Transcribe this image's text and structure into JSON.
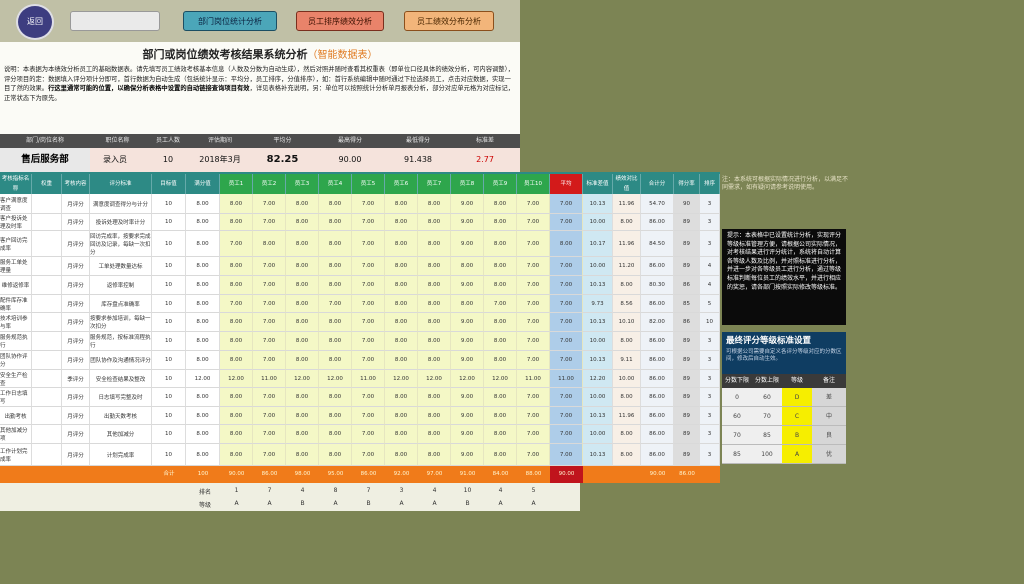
{
  "toolbar": {
    "logo_text": "返回",
    "btn_input": "",
    "btn_dept": "部门岗位统计分析",
    "btn_staff": "员工排序绩效分析",
    "btn_dist": "员工绩效分布分析"
  },
  "header": {
    "title": "部门或岗位绩效考核结果系统分析",
    "subtitle": "（智能数据表）",
    "desc_1": "说明：本表据为本绩效分析员工的基础数据表。请先填写员工绩效考核基本信息（人数及分数为自动生成），然后对照并随时查看其权重表（即单位口径具体的绩效分析，可内容调整），评分项目的定：数据填入评分项计分即可，首行数据为自动生成（包括统计显示：平均分，员工排序，分值排序），如：首行系统编辑中随时通过下拉选择员工，点击对应数据，实现一目了然的效果。",
    "desc_bold": "行这里通常可能的位置，以确保分析表格中设置的自动链接查询项目有效",
    "desc_2": "，详见表格补充说明，另：单位可以按照统计分析单月报表分析，部分对应单元格为对应标记，正常状态下为原先。"
  },
  "info": {
    "headers": [
      "部门/岗位名称",
      "职位名称",
      "员工人数",
      "评估期间",
      "平均分",
      "最高得分",
      "最低得分",
      "标准差"
    ],
    "dept": "售后服务部",
    "position": "录入员",
    "count": "10",
    "period": "2018年3月",
    "avg": "82.25",
    "max": "90.00",
    "min": "91.438",
    "std": "2.77"
  },
  "table": {
    "headers": [
      "考核指标名称",
      "权重",
      "考核内容",
      "评分标准",
      "目标值",
      "满分值",
      "员工1",
      "员工2",
      "员工3",
      "员工4",
      "员工5",
      "员工6",
      "员工7",
      "员工8",
      "员工9",
      "员工10",
      "员工11",
      "平均",
      "标准差值",
      "绩效对比值",
      "合计分",
      "得分率",
      "排序"
    ],
    "rows": [
      {
        "name": "客户满意度调查",
        "weight": "",
        "cat": "月评分",
        "content": "满意度调查得分与计分",
        "target": "10",
        "full": "8.00",
        "s": [
          "8.00",
          "7.00",
          "8.00",
          "8.00",
          "7.00",
          "8.00",
          "8.00",
          "9.00",
          "8.00",
          "7.00",
          "7.00"
        ],
        "avg": "7.73",
        "std": "10.13",
        "cmp": "11.96",
        "sum": "54.70",
        "rate": "90",
        "rank": "3"
      },
      {
        "name": "客户投诉处理及时率",
        "weight": "",
        "cat": "月评分",
        "content": "投诉处理及时率计分",
        "target": "10",
        "full": "8.00",
        "s": [
          "8.00",
          "7.00",
          "8.00",
          "8.00",
          "7.00",
          "8.00",
          "8.00",
          "9.00",
          "8.00",
          "7.00",
          "7.00"
        ],
        "avg": "7.64",
        "std": "10.00",
        "cmp": "8.00",
        "sum": "86.00",
        "rate": "89",
        "rank": "3"
      },
      {
        "name": "客户回访完成率",
        "weight": "",
        "cat": "月评分",
        "content": "回访完成率，按要求完成回访及记录，每缺一次扣分",
        "target": "10",
        "full": "8.00",
        "s": [
          "7.00",
          "8.00",
          "8.00",
          "8.00",
          "7.00",
          "8.00",
          "8.00",
          "9.00",
          "8.00",
          "7.00",
          "8.00"
        ],
        "avg": "7.82",
        "std": "10.17",
        "cmp": "11.96",
        "sum": "84.50",
        "rate": "89",
        "rank": "3"
      },
      {
        "name": "服务工单处理量",
        "weight": "",
        "cat": "月评分",
        "content": "工单处理数量达标",
        "target": "10",
        "full": "8.00",
        "s": [
          "8.00",
          "7.00",
          "8.00",
          "8.00",
          "7.00",
          "8.00",
          "8.00",
          "8.00",
          "8.00",
          "7.00",
          "7.00"
        ],
        "avg": "7.64",
        "std": "10.00",
        "cmp": "11.20",
        "sum": "86.00",
        "rate": "89",
        "rank": "4"
      },
      {
        "name": "维修返修率",
        "weight": "",
        "cat": "月评分",
        "content": "返修率控制",
        "target": "10",
        "full": "8.00",
        "s": [
          "8.00",
          "7.00",
          "8.00",
          "8.00",
          "7.00",
          "8.00",
          "8.00",
          "9.00",
          "8.00",
          "7.00",
          "7.00"
        ],
        "avg": "7.73",
        "std": "10.13",
        "cmp": "8.00",
        "sum": "80.30",
        "rate": "86",
        "rank": "4"
      },
      {
        "name": "配件库存准确率",
        "weight": "",
        "cat": "月评分",
        "content": "库存盘点准确率",
        "target": "10",
        "full": "8.00",
        "s": [
          "7.00",
          "7.00",
          "8.00",
          "7.00",
          "7.00",
          "8.00",
          "8.00",
          "8.00",
          "7.00",
          "7.00",
          "7.00"
        ],
        "avg": "7.36",
        "std": "9.73",
        "cmp": "8.56",
        "sum": "86.00",
        "rate": "85",
        "rank": "5"
      },
      {
        "name": "技术培训参与率",
        "weight": "",
        "cat": "月评分",
        "content": "按要求参加培训，每缺一次扣分",
        "target": "10",
        "full": "8.00",
        "s": [
          "8.00",
          "7.00",
          "8.00",
          "8.00",
          "7.00",
          "8.00",
          "8.00",
          "9.00",
          "8.00",
          "7.00",
          "7.00"
        ],
        "avg": "7.73",
        "std": "10.13",
        "cmp": "10.10",
        "sum": "82.00",
        "rate": "86",
        "rank": "10"
      },
      {
        "name": "服务规范执行",
        "weight": "",
        "cat": "月评分",
        "content": "服务规范，按标准流程执行",
        "target": "10",
        "full": "8.00",
        "s": [
          "8.00",
          "7.00",
          "8.00",
          "8.00",
          "7.00",
          "8.00",
          "8.00",
          "9.00",
          "8.00",
          "7.00",
          "7.00"
        ],
        "avg": "7.73",
        "std": "10.00",
        "cmp": "8.00",
        "sum": "86.00",
        "rate": "89",
        "rank": "3"
      },
      {
        "name": "团队协作评分",
        "weight": "",
        "cat": "月评分",
        "content": "团队协作及沟通情况评分",
        "target": "10",
        "full": "8.00",
        "s": [
          "8.00",
          "7.00",
          "8.00",
          "8.00",
          "7.00",
          "8.00",
          "8.00",
          "9.00",
          "8.00",
          "7.00",
          "7.00"
        ],
        "avg": "7.73",
        "std": "10.13",
        "cmp": "9.11",
        "sum": "86.00",
        "rate": "89",
        "rank": "3"
      },
      {
        "name": "安全生产检查",
        "weight": "",
        "cat": "季评分",
        "content": "安全检查结果及整改",
        "target": "10",
        "full": "12.00",
        "s": [
          "12.00",
          "11.00",
          "12.00",
          "12.00",
          "11.00",
          "12.00",
          "12.00",
          "12.00",
          "12.00",
          "11.00",
          "11.00"
        ],
        "avg": "11.64",
        "std": "12.20",
        "cmp": "10.00",
        "sum": "86.00",
        "rate": "89",
        "rank": "3"
      },
      {
        "name": "工作日志填写",
        "weight": "",
        "cat": "月评分",
        "content": "日志填写完整及时",
        "target": "10",
        "full": "8.00",
        "s": [
          "8.00",
          "7.00",
          "8.00",
          "8.00",
          "7.00",
          "8.00",
          "8.00",
          "9.00",
          "8.00",
          "7.00",
          "7.00"
        ],
        "avg": "7.73",
        "std": "10.00",
        "cmp": "8.00",
        "sum": "86.00",
        "rate": "89",
        "rank": "3"
      },
      {
        "name": "出勤考核",
        "weight": "",
        "cat": "月评分",
        "content": "出勤天数考核",
        "target": "10",
        "full": "8.00",
        "s": [
          "8.00",
          "7.00",
          "8.00",
          "8.00",
          "7.00",
          "8.00",
          "8.00",
          "9.00",
          "8.00",
          "7.00",
          "7.00"
        ],
        "avg": "7.73",
        "std": "10.13",
        "cmp": "11.96",
        "sum": "86.00",
        "rate": "89",
        "rank": "3"
      },
      {
        "name": "其他加减分项",
        "weight": "",
        "cat": "月评分",
        "content": "其他加减分",
        "target": "10",
        "full": "8.00",
        "s": [
          "8.00",
          "7.00",
          "8.00",
          "8.00",
          "7.00",
          "8.00",
          "8.00",
          "9.00",
          "8.00",
          "7.00",
          "7.00"
        ],
        "avg": "7.73",
        "std": "10.00",
        "cmp": "8.00",
        "sum": "86.00",
        "rate": "89",
        "rank": "3"
      },
      {
        "name": "工作计划完成率",
        "weight": "",
        "cat": "月评分",
        "content": "计划完成率",
        "target": "10",
        "full": "8.00",
        "s": [
          "8.00",
          "7.00",
          "8.00",
          "8.00",
          "7.00",
          "8.00",
          "8.00",
          "9.00",
          "8.00",
          "7.00",
          "7.00"
        ],
        "avg": "7.73",
        "std": "10.13",
        "cmp": "8.00",
        "sum": "86.00",
        "rate": "89",
        "rank": "3"
      }
    ],
    "total": {
      "label": "合计",
      "full": "100",
      "s": [
        "90.00",
        "86.00",
        "98.00",
        "95.00",
        "86.00",
        "92.00",
        "97.00",
        "91.00",
        "84.00",
        "88.00",
        "90.00"
      ],
      "avg": "90.00",
      "sum": "90.00",
      "rate": "86.00"
    },
    "rank_label": "排名",
    "ranks": [
      "1",
      "7",
      "4",
      "8",
      "7",
      "3",
      "4",
      "10",
      "4",
      "5"
    ],
    "grade_label": "等级",
    "grades": [
      "A",
      "A",
      "B",
      "A",
      "B",
      "A",
      "A",
      "B",
      "A",
      "A"
    ]
  },
  "right": {
    "note": "注：本系统可根据实际情况进行分析，以满足不同需求，如有疑问请参考说明使用。",
    "tooltip": "提示：本表格中已设置统计分析，实现评分等级标准管理方便，请根据公司实际情况，对考核结果进行评分统计，系统将自动计算各等级人数及比例，并对照标准进行分析，并进一步对各等级员工进行分析，通过等级标准判断每位员工的绩效水平，并进行相应的奖惩，请各部门按照实际修改等级标准。",
    "grade_title": "最终评分等级标准设置",
    "grade_sub": "可根据公司需要自定义各评分等级对应的分数区间，修改后自动生效。",
    "grade_headers": [
      "分数下限",
      "分数上限",
      "等级",
      "备注"
    ],
    "grade_rows": [
      [
        "0",
        "60",
        "D",
        "差"
      ],
      [
        "60",
        "70",
        "C",
        "中"
      ],
      [
        "70",
        "85",
        "B",
        "良"
      ],
      [
        "85",
        "100",
        "A",
        "优"
      ]
    ]
  }
}
